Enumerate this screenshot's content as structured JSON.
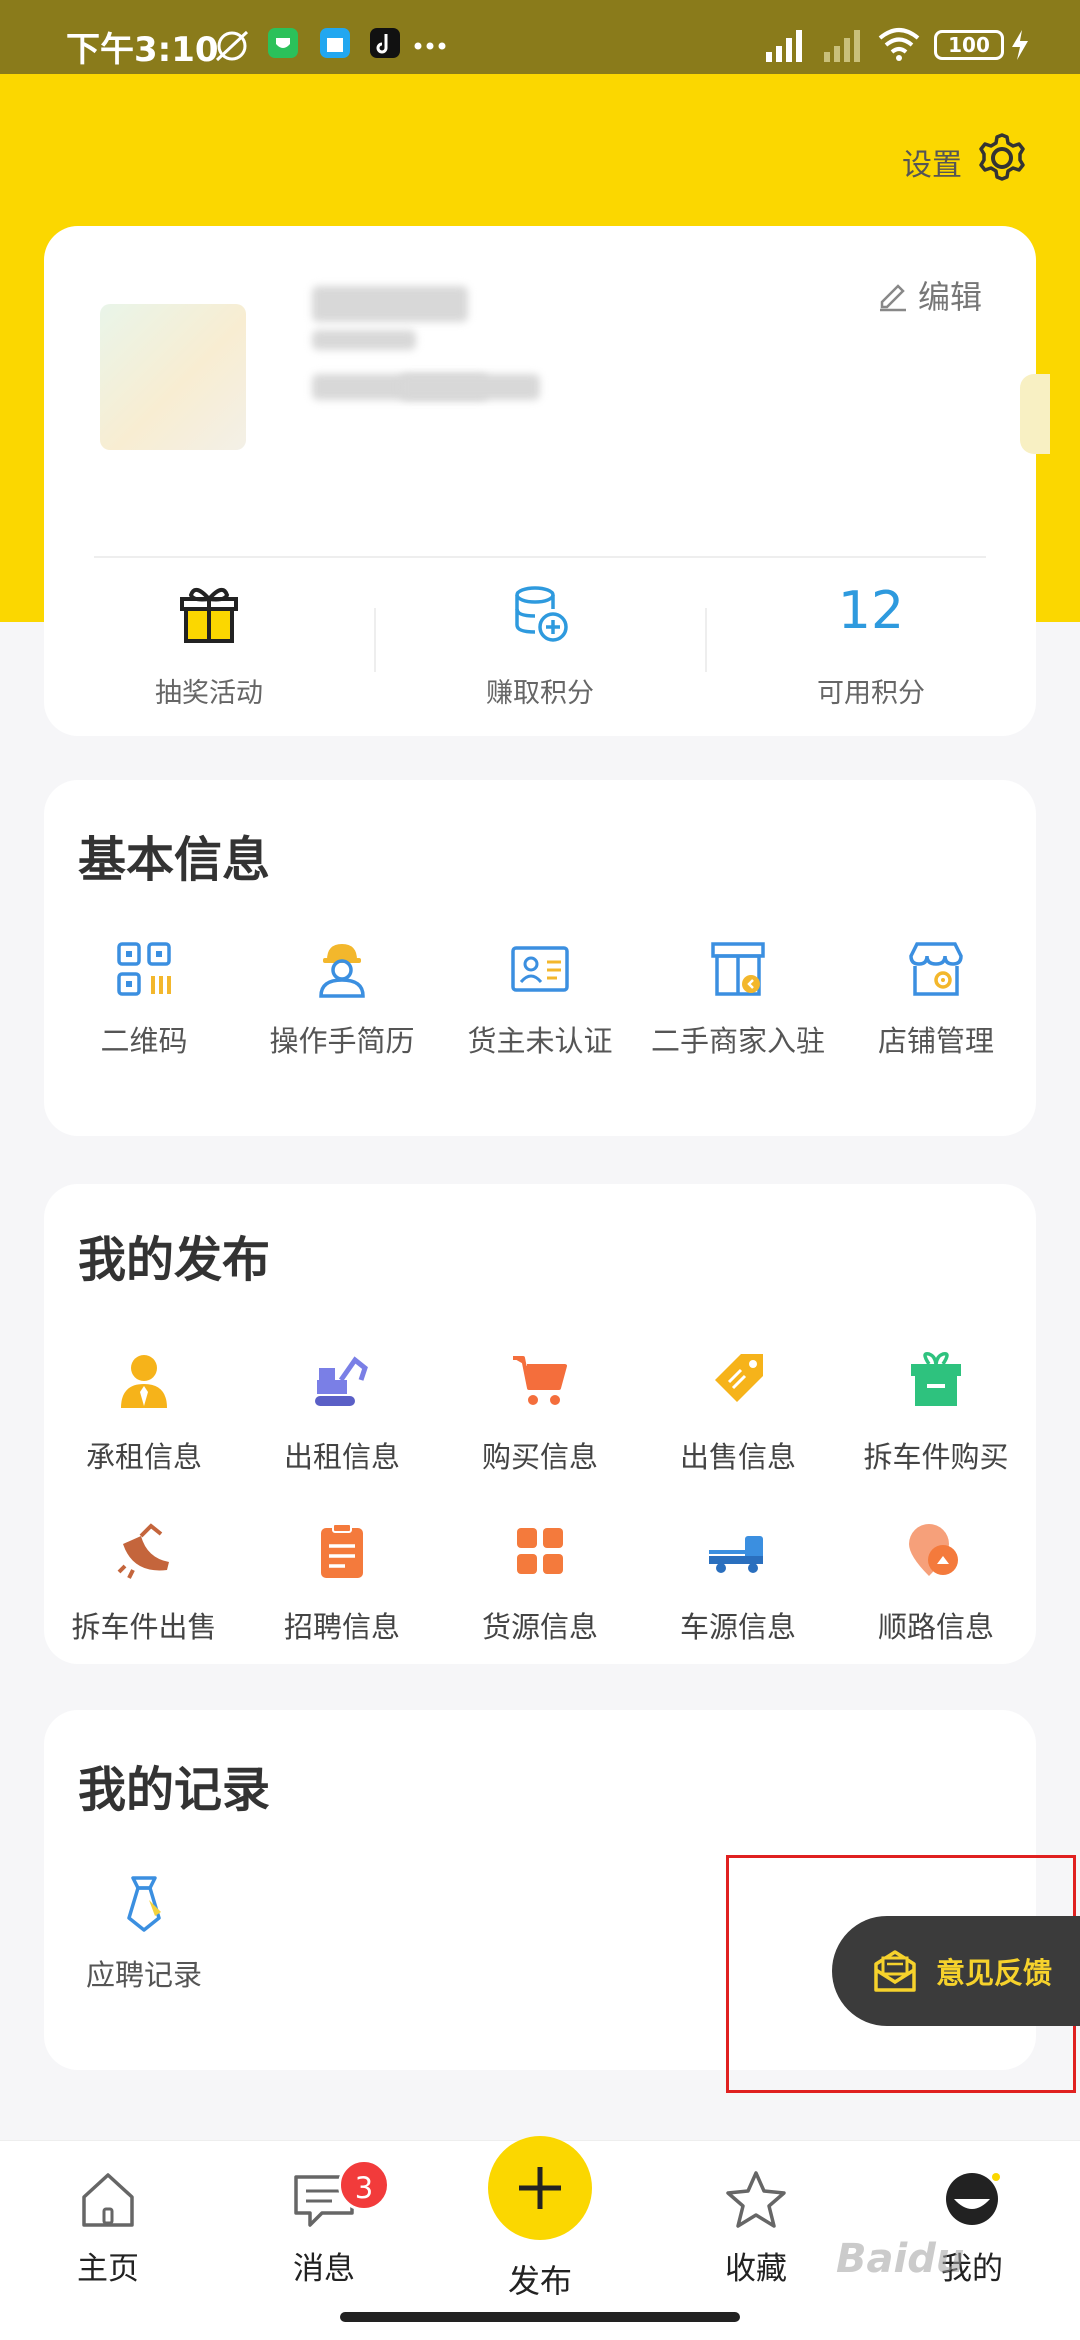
{
  "status_bar": {
    "time": "下午3:10",
    "battery": "100"
  },
  "header": {
    "settings_label": "设置",
    "edit_label": "编辑"
  },
  "profile": {
    "stats": [
      {
        "label": "抽奖活动",
        "icon": "gift-icon"
      },
      {
        "label": "赚取积分",
        "icon": "database-plus-icon"
      },
      {
        "label": "可用积分",
        "value": "12"
      }
    ]
  },
  "basic_info": {
    "title": "基本信息",
    "items": [
      {
        "label": "二维码",
        "icon": "qrcode-icon"
      },
      {
        "label": "操作手简历",
        "icon": "worker-icon"
      },
      {
        "label": "货主未认证",
        "icon": "id-card-icon"
      },
      {
        "label": "二手商家入驻",
        "icon": "shop-enter-icon"
      },
      {
        "label": "店铺管理",
        "icon": "store-settings-icon"
      }
    ]
  },
  "my_publish": {
    "title": "我的发布",
    "items": [
      {
        "label": "承租信息",
        "icon": "user-icon"
      },
      {
        "label": "出租信息",
        "icon": "excavator-icon"
      },
      {
        "label": "购买信息",
        "icon": "cart-icon"
      },
      {
        "label": "出售信息",
        "icon": "tag-icon"
      },
      {
        "label": "拆车件购买",
        "icon": "gift-box-icon"
      },
      {
        "label": "拆车件出售",
        "icon": "bucket-icon"
      },
      {
        "label": "招聘信息",
        "icon": "clipboard-icon"
      },
      {
        "label": "货源信息",
        "icon": "grid-icon"
      },
      {
        "label": "车源信息",
        "icon": "truck-icon"
      },
      {
        "label": "顺路信息",
        "icon": "route-icon"
      }
    ]
  },
  "my_records": {
    "title": "我的记录",
    "items": [
      {
        "label": "应聘记录",
        "icon": "tie-icon"
      }
    ]
  },
  "feedback": {
    "label": "意见反馈"
  },
  "nav": {
    "items": [
      {
        "label": "主页",
        "icon": "home-icon"
      },
      {
        "label": "消息",
        "icon": "message-icon",
        "badge": "3"
      },
      {
        "label": "发布",
        "icon": "plus-icon"
      },
      {
        "label": "收藏",
        "icon": "star-icon"
      },
      {
        "label": "我的",
        "icon": "profile-face-icon"
      }
    ]
  },
  "colors": {
    "brand_yellow": "#fbd700",
    "accent_blue": "#2e9ade",
    "badge_red": "#f23b3b"
  }
}
